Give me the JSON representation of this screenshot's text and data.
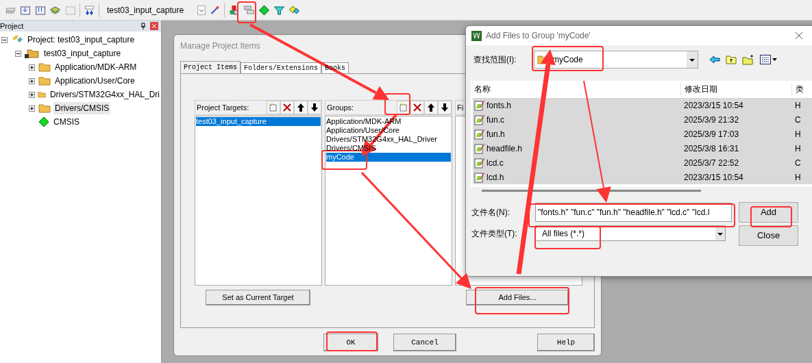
{
  "toolbar": {
    "target": "test03_input_capture"
  },
  "project_panel": {
    "title": "Project",
    "tree": [
      {
        "label": "Project: test03_input_capture",
        "kind": "project",
        "expanded": true,
        "children": [
          {
            "label": "test03_input_capture",
            "kind": "target",
            "expanded": true,
            "children": [
              {
                "label": "Application/MDK-ARM",
                "kind": "group",
                "expanded": false,
                "selected": false
              },
              {
                "label": "Application/User/Core",
                "kind": "group",
                "expanded": false,
                "selected": false
              },
              {
                "label": "Drivers/STM32G4xx_HAL_Dri",
                "kind": "group",
                "expanded": false,
                "selected": false
              },
              {
                "label": "Drivers/CMSIS",
                "kind": "group",
                "expanded": false,
                "selected": true
              },
              {
                "label": "CMSIS",
                "kind": "component",
                "selected": false
              }
            ]
          }
        ]
      }
    ]
  },
  "manage_dialog": {
    "title": "Manage Project Items",
    "tabs": [
      {
        "label": "Project Items",
        "selected": true
      },
      {
        "label": "Folders/Extensions",
        "selected": false
      },
      {
        "label": "Books",
        "selected": false
      }
    ],
    "targets": {
      "label": "Project Targets:",
      "items": [
        {
          "label": "test03_input_capture",
          "selected": true
        }
      ]
    },
    "groups": {
      "label": "Groups:",
      "items": [
        {
          "label": "Application/MDK-ARM",
          "selected": false
        },
        {
          "label": "Application/User/Core",
          "selected": false
        },
        {
          "label": "Drivers/STM32G4xx_HAL_Driver",
          "selected": false
        },
        {
          "label": "Drivers/CMSIS",
          "selected": false
        },
        {
          "label": "myCode",
          "selected": true
        }
      ]
    },
    "files": {
      "label": "Fi"
    },
    "set_target_button": "Set as Current Target",
    "add_files_button": "Add Files...",
    "buttons": [
      "OK",
      "Cancel",
      "Help"
    ]
  },
  "add_dialog": {
    "title": "Add Files to Group 'myCode'",
    "look_in_label": "查找范围(I):",
    "look_in": "myCode",
    "columns": [
      "名称",
      "修改日期",
      "类"
    ],
    "files": [
      {
        "name": "fonts.h",
        "date": "2023/3/15 10:54",
        "type": "H",
        "selected": true
      },
      {
        "name": "fun.c",
        "date": "2025/3/9 21:32",
        "type": "C",
        "selected": true
      },
      {
        "name": "fun.h",
        "date": "2025/3/9 17:03",
        "type": "H",
        "selected": true
      },
      {
        "name": "headfile.h",
        "date": "2025/3/8 16:31",
        "type": "H",
        "selected": true
      },
      {
        "name": "lcd.c",
        "date": "2025/3/7 22:52",
        "type": "C",
        "selected": true
      },
      {
        "name": "lcd.h",
        "date": "2023/3/15 10:54",
        "type": "H",
        "selected": true
      }
    ],
    "file_name_label": "文件名(N):",
    "file_name": "\"fonts.h\" \"fun.c\" \"fun.h\" \"headfile.h\" \"lcd.c\" \"lcd.l",
    "file_type_label": "文件类型(T):",
    "file_type": "All files (*.*)",
    "add_button": "Add",
    "close_button": "Close"
  }
}
